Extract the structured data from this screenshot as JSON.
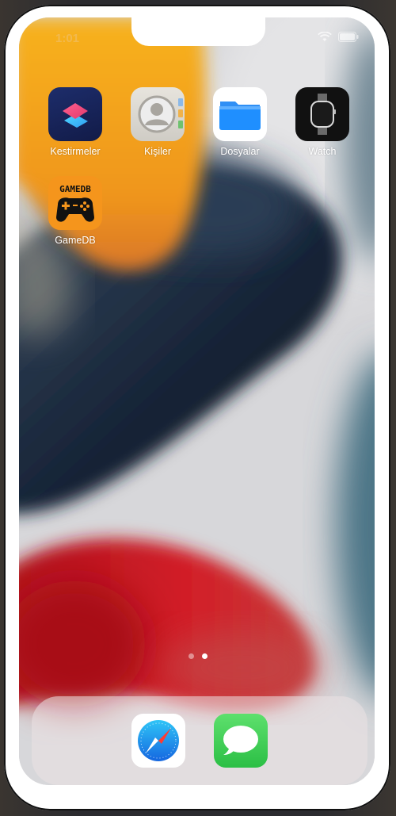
{
  "status_bar": {
    "time": "1:01"
  },
  "apps": [
    {
      "label": "Kestirmeler",
      "icon": "shortcuts-icon"
    },
    {
      "label": "Kişiler",
      "icon": "contacts-icon"
    },
    {
      "label": "Dosyalar",
      "icon": "files-folder-icon"
    },
    {
      "label": "Watch",
      "icon": "watch-icon"
    },
    {
      "label": "GameDB",
      "icon": "gamepad-icon",
      "icon_text": "GAMEDB"
    }
  ],
  "page_indicator": {
    "pages": 2,
    "current": 2
  },
  "dock": [
    {
      "icon": "safari-compass-icon"
    },
    {
      "icon": "messages-bubble-icon"
    }
  ],
  "colors": {
    "wallpaper_orange": "#f2a51c",
    "wallpaper_navy": "#1e2e45",
    "wallpaper_red": "#c21a22",
    "wallpaper_teal": "#4a6f80",
    "files_blue": "#1f8fff",
    "messages_green": "#35c759"
  }
}
